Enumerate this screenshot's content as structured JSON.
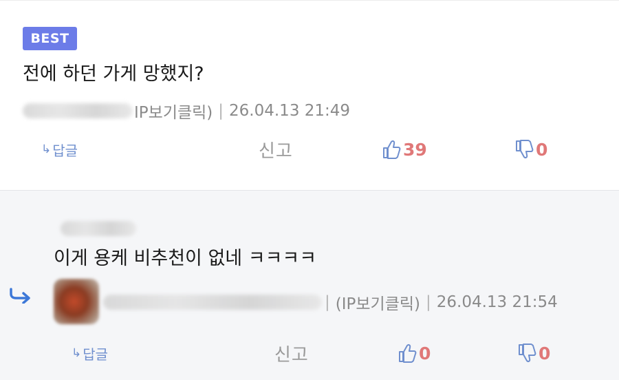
{
  "comment": {
    "badge": "BEST",
    "text": "전에 하던 가게 망했지?",
    "ip_label": "IP보기클릭)",
    "separator": "|",
    "timestamp": "26.04.13 21:49",
    "reply_label": "답글",
    "report_label": "신고",
    "likes": "39",
    "dislikes": "0"
  },
  "reply": {
    "text": "이게 용케 비추천이 없네 ㅋㅋㅋㅋ",
    "ip_label": "(IP보기클릭)",
    "separator_before": "|",
    "separator": "|",
    "timestamp": "26.04.13 21:54",
    "reply_label": "답글",
    "report_label": "신고",
    "likes": "0",
    "dislikes": "0"
  },
  "icons": {
    "reply_arrow": "reply-arrow-icon",
    "thumbs_up": "thumbs-up-icon",
    "thumbs_down": "thumbs-down-icon"
  },
  "colors": {
    "badge": "#6c7ce8",
    "link": "#6f8fce",
    "count": "#e07878",
    "reply_bg": "#f5f6f8"
  }
}
